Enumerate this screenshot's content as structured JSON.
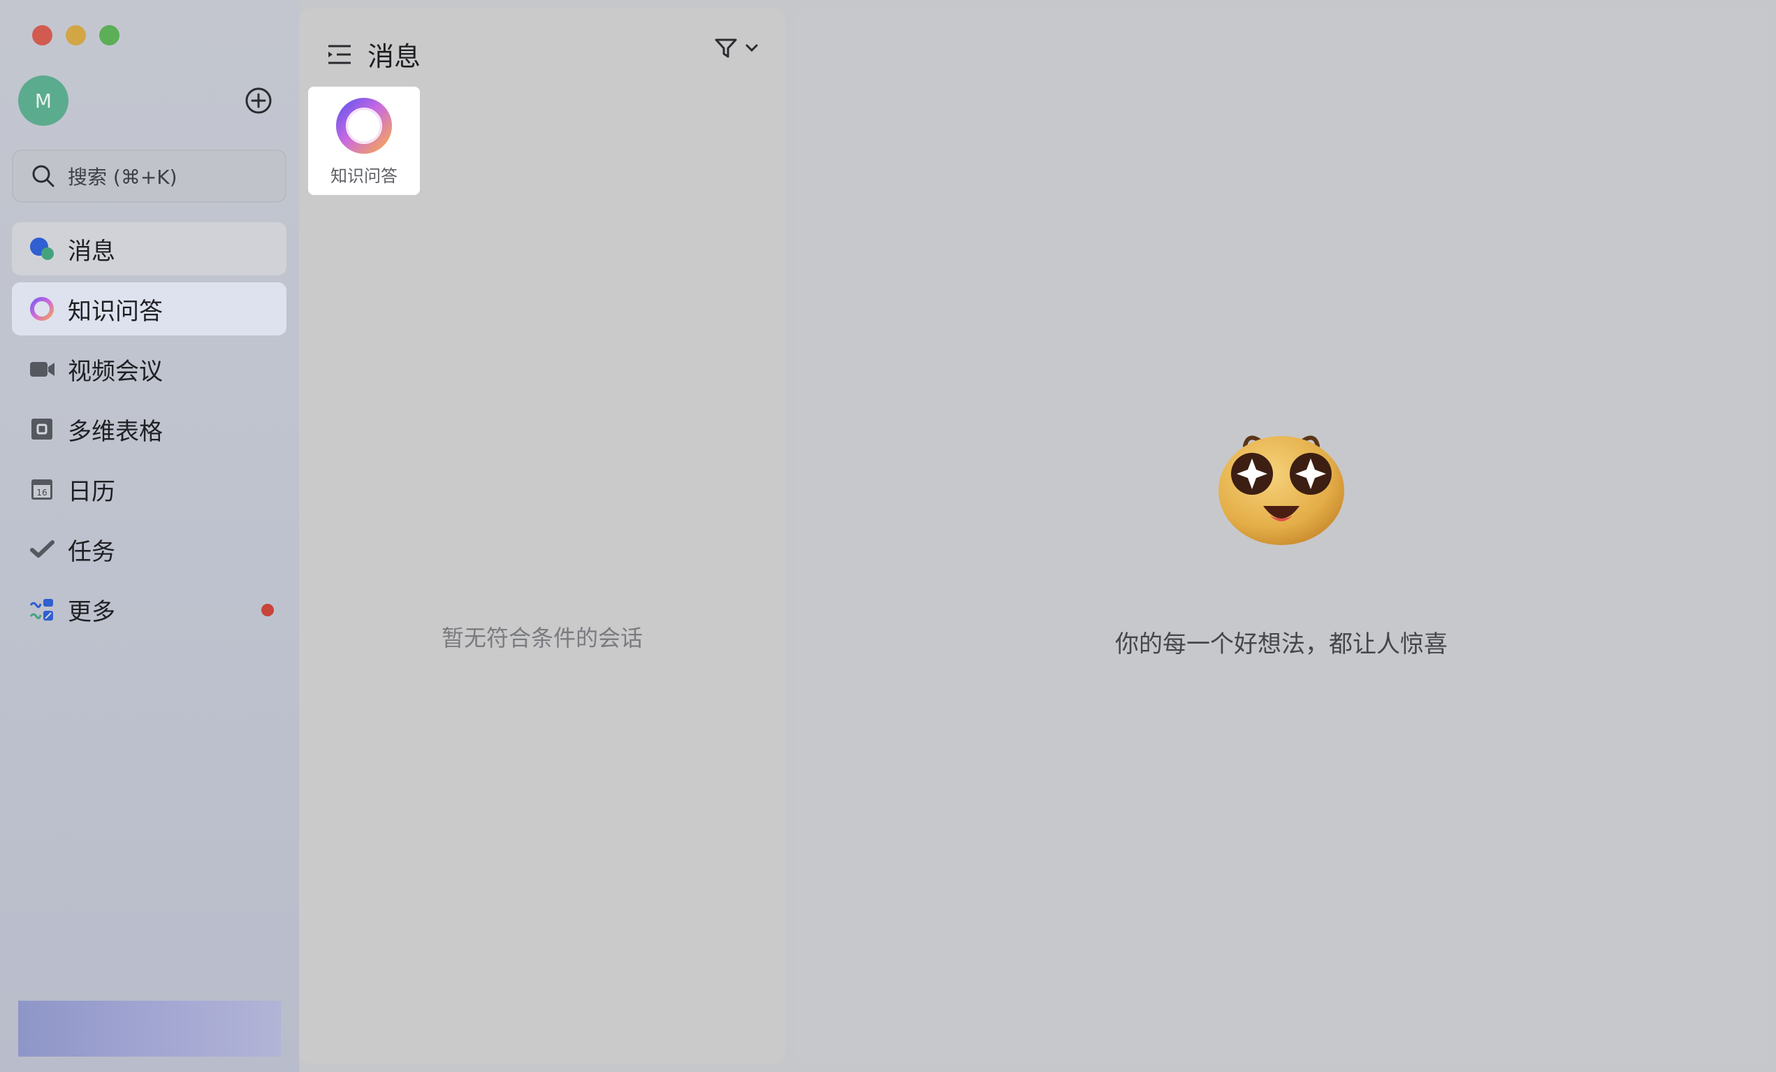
{
  "sidebar": {
    "avatar_initial": "M",
    "search_placeholder": "搜索 (⌘+K)",
    "items": [
      {
        "id": "messages",
        "label": "消息",
        "icon": "chat-bubbles-icon",
        "state": "hover"
      },
      {
        "id": "knowledge-qa",
        "label": "知识问答",
        "icon": "ai-ring-icon",
        "state": "active"
      },
      {
        "id": "video-meeting",
        "label": "视频会议",
        "icon": "video-camera-icon",
        "state": ""
      },
      {
        "id": "multi-table",
        "label": "多维表格",
        "icon": "table-icon",
        "state": ""
      },
      {
        "id": "calendar",
        "label": "日历",
        "icon": "calendar-icon",
        "state": ""
      },
      {
        "id": "tasks",
        "label": "任务",
        "icon": "checkmark-icon",
        "state": ""
      },
      {
        "id": "more",
        "label": "更多",
        "icon": "apps-grid-icon",
        "state": "",
        "badge": true
      }
    ]
  },
  "list": {
    "title": "消息",
    "pinned": [
      {
        "label": "知识问答",
        "icon": "ai-ring-icon"
      }
    ],
    "empty_text": "暂无符合条件的会话"
  },
  "detail": {
    "slogan": "你的每一个好想法，都让人惊喜"
  },
  "colors": {
    "badge": "#c8443a",
    "active_item": "#dde2ee",
    "avatar": "#5bab8e"
  }
}
